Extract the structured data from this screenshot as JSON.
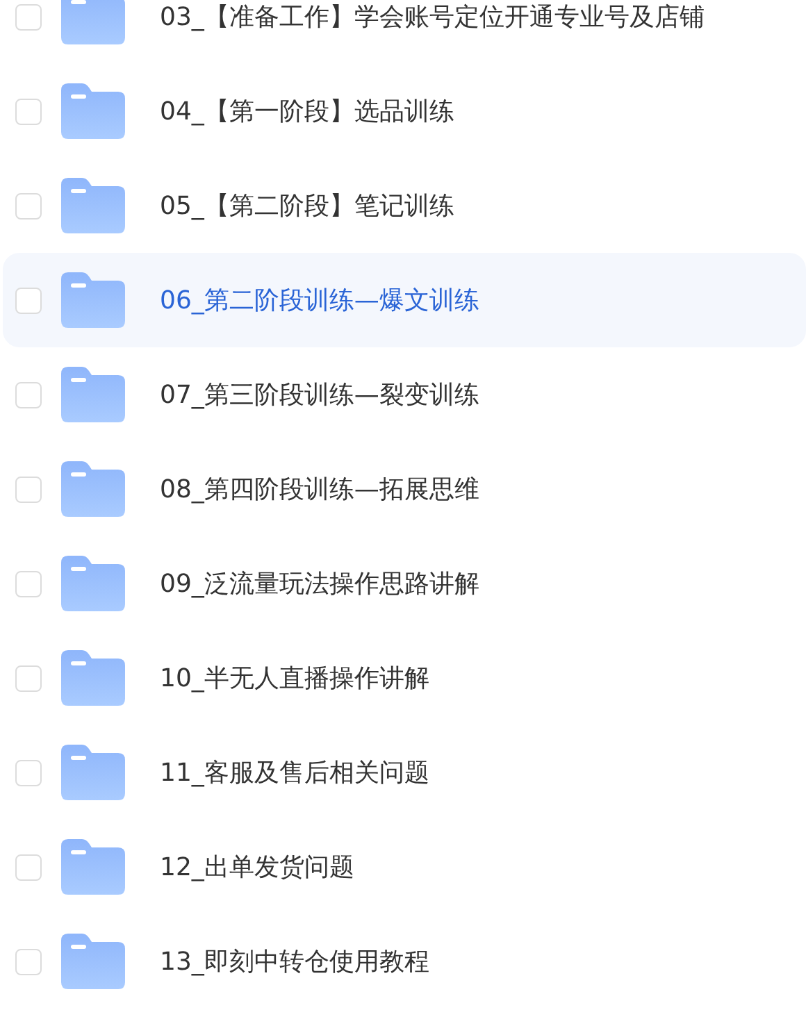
{
  "folders": [
    {
      "name": "03_【准备工作】学会账号定位开通专业号及店铺",
      "selected": false,
      "checked": false
    },
    {
      "name": "04_【第一阶段】选品训练",
      "selected": false,
      "checked": false
    },
    {
      "name": "05_【第二阶段】笔记训练",
      "selected": false,
      "checked": false
    },
    {
      "name": "06_第二阶段训练—爆文训练",
      "selected": true,
      "checked": false
    },
    {
      "name": "07_第三阶段训练—裂变训练",
      "selected": false,
      "checked": false
    },
    {
      "name": "08_第四阶段训练—拓展思维",
      "selected": false,
      "checked": false
    },
    {
      "name": "09_泛流量玩法操作思路讲解",
      "selected": false,
      "checked": false
    },
    {
      "name": "10_半无人直播操作讲解",
      "selected": false,
      "checked": false
    },
    {
      "name": "11_客服及售后相关问题",
      "selected": false,
      "checked": false
    },
    {
      "name": "12_出单发货问题",
      "selected": false,
      "checked": false
    },
    {
      "name": "13_即刻中转仓使用教程",
      "selected": false,
      "checked": false
    }
  ]
}
